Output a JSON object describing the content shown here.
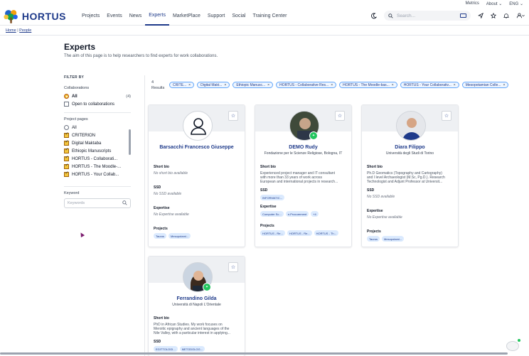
{
  "util": {
    "metrics": "Metrics",
    "about": "About",
    "lang": "ENG"
  },
  "logo": {
    "word": "HORTUS"
  },
  "nav": [
    "Projects",
    "Events",
    "News",
    "Experts",
    "MarketPlace",
    "Support",
    "Social",
    "Training Center"
  ],
  "search": {
    "placeholder": "Search..."
  },
  "breadcrumb": {
    "home": "Home",
    "sep": "|",
    "current": "People"
  },
  "page": {
    "title": "Experts",
    "subtitle": "The aim of this page is to help researchers to find experts for work collaborations."
  },
  "filter": {
    "heading": "FILTER BY",
    "collaborations_title": "Collaborations",
    "collab_all": "All",
    "collab_all_count": "(4)",
    "collab_open": "Open to collaborations",
    "projects_title": "Project pages",
    "projects": [
      "All",
      "CRITERION",
      "Digital Maktaba",
      "Ethiopic Manuscripts",
      "HORTUS - Collaborati...",
      "HORTUS - The Moodle-...",
      "HORTUS - Your Collab..."
    ],
    "keyword_title": "Keyword",
    "keyword_placeholder": "Keywords"
  },
  "results": {
    "count": "4",
    "label": "Results"
  },
  "chips": [
    "CRITE...",
    "Digital Makt...",
    "Ethiopic Manusc...",
    "HORTUS - Collaborative Res...",
    "HORTUS - The Moodle-bas...",
    "HORTUS - Your Collaborativ...",
    "Mesopotamian Colle..."
  ],
  "labels": {
    "short_bio": "Short bio",
    "ssd": "SSD",
    "expertise": "Expertise",
    "projects": "Projects"
  },
  "cards": [
    {
      "name": "Barsacchi Francesco Giuseppe",
      "affiliation": "",
      "bio": [
        "No short bio available"
      ],
      "ssd": "No SSD available",
      "expertise": "No Expertise available",
      "projects": [
        "Taurus",
        "Mesopotami..."
      ]
    },
    {
      "name": "DEMO Rudy",
      "affiliation": "Fondazione per le Scienze Religiose, Bologna, IT",
      "bio": [
        "Experienced project manager and IT consultant",
        "with more than 33 years of work across",
        "European and international projects in research..."
      ],
      "ssd": [
        "INFORMATIC..."
      ],
      "expertise": [
        "Computer Sc...",
        "e-Procurement",
        "+4"
      ],
      "projects": [
        "HORTUS - Re...",
        "HORTUS - Re...",
        "HORTUS - Th..."
      ]
    },
    {
      "name": "Diara Filippo",
      "affiliation": "Università degli Studi di Torino",
      "bio": [
        "Ph.D Geomatics (Topography and Cartography)",
        "and I level Archaeologist (M.Sc, Pg.D.). Research",
        "Technologist and Adjunt Professor at Universit..."
      ],
      "ssd": "No SSD available",
      "expertise": "No Expertise available",
      "projects": [
        "Taurus",
        "Mesopotami..."
      ]
    },
    {
      "name": "Ferrandino Gilda",
      "affiliation": "Università di Napoli L'Orientale",
      "bio": [
        "PhD in African Studies. My work focuses on",
        "Meroitic epigraphy and ancient languages of the",
        "Nile Valley, with a particular interest in applying..."
      ],
      "ssd": [
        "EGITTOLOGI...",
        "METODOLOG..."
      ]
    }
  ],
  "colors": {
    "brand": "#1e3a8a",
    "accent": "#f3c53b",
    "badge": "#22c55e"
  }
}
